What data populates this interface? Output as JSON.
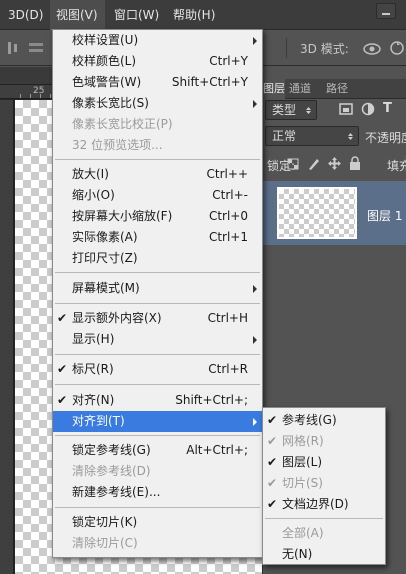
{
  "menubar": {
    "items": [
      {
        "label": "3D(D)"
      },
      {
        "label": "视图(V)",
        "active": true
      },
      {
        "label": "窗口(W)"
      },
      {
        "label": "帮助(H)"
      }
    ]
  },
  "options_bar": {
    "mode_label": "3D 模式:"
  },
  "ruler": {
    "tick_label": "25"
  },
  "layers_panel": {
    "tabs": [
      "图层",
      "通道",
      "路径"
    ],
    "filter_select": "类型",
    "blend_mode": "正常",
    "opacity_label": "不透明度",
    "lock_label": "锁定:",
    "fill_label": "填充",
    "layer_name": "图层 1"
  },
  "view_menu": {
    "items": [
      {
        "label": "校样设置(U)",
        "shortcut": "",
        "submenu": true
      },
      {
        "label": "校样颜色(L)",
        "shortcut": "Ctrl+Y"
      },
      {
        "label": "色域警告(W)",
        "shortcut": "Shift+Ctrl+Y"
      },
      {
        "label": "像素长宽比(S)",
        "shortcut": "",
        "submenu": true
      },
      {
        "label": "像素长宽比校正(P)",
        "shortcut": "",
        "disabled": true
      },
      {
        "label": "32 位预览选项...",
        "shortcut": "",
        "disabled": true
      },
      {
        "label": "放大(I)",
        "shortcut": "Ctrl++"
      },
      {
        "label": "缩小(O)",
        "shortcut": "Ctrl+-"
      },
      {
        "label": "按屏幕大小缩放(F)",
        "shortcut": "Ctrl+0"
      },
      {
        "label": "实际像素(A)",
        "shortcut": "Ctrl+1"
      },
      {
        "label": "打印尺寸(Z)",
        "shortcut": ""
      },
      {
        "label": "屏幕模式(M)",
        "shortcut": "",
        "submenu": true
      },
      {
        "label": "显示额外内容(X)",
        "shortcut": "Ctrl+H",
        "checked": true
      },
      {
        "label": "显示(H)",
        "shortcut": "",
        "submenu": true
      },
      {
        "label": "标尺(R)",
        "shortcut": "Ctrl+R",
        "checked": true
      },
      {
        "label": "对齐(N)",
        "shortcut": "Shift+Ctrl+;",
        "checked": true
      },
      {
        "label": "对齐到(T)",
        "shortcut": "",
        "submenu": true,
        "highlighted": true
      },
      {
        "label": "锁定参考线(G)",
        "shortcut": "Alt+Ctrl+;"
      },
      {
        "label": "清除参考线(D)",
        "shortcut": "",
        "disabled": true
      },
      {
        "label": "新建参考线(E)...",
        "shortcut": ""
      },
      {
        "label": "锁定切片(K)",
        "shortcut": ""
      },
      {
        "label": "清除切片(C)",
        "shortcut": "",
        "disabled": true
      }
    ]
  },
  "snap_to_submenu": {
    "items": [
      {
        "label": "参考线(G)",
        "checked": true
      },
      {
        "label": "网格(R)",
        "checked": true,
        "disabled": true
      },
      {
        "label": "图层(L)",
        "checked": true
      },
      {
        "label": "切片(S)",
        "checked": true,
        "disabled": true
      },
      {
        "label": "文档边界(D)",
        "checked": true
      },
      {
        "label": "全部(A)",
        "disabled": true
      },
      {
        "label": "无(N)"
      }
    ]
  },
  "colors": {
    "menu_bg": "#f0f0f0",
    "highlight": "#3a7be0",
    "disabled_text": "#9a9a9a",
    "panel_bg": "#535353",
    "selected_layer": "#5b6e8a"
  }
}
